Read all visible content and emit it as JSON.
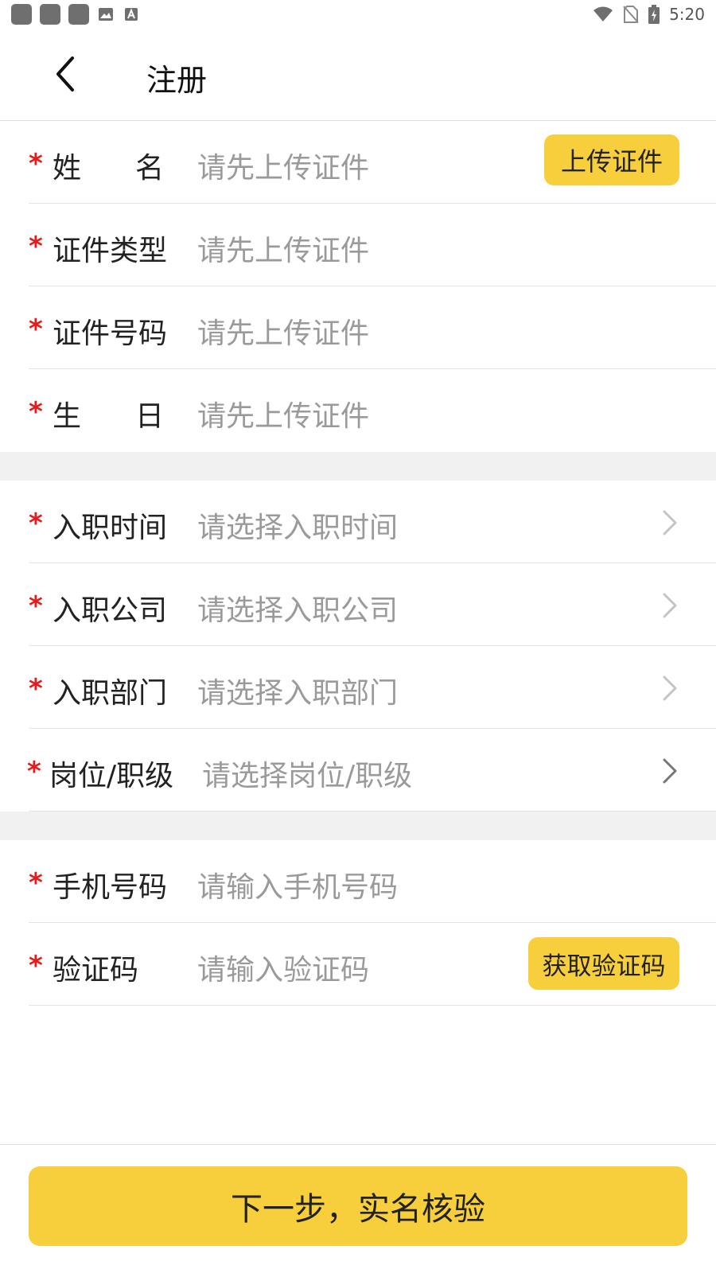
{
  "status_bar": {
    "time": "5:20",
    "icons": [
      "notification-icon",
      "notification-icon",
      "notification-icon",
      "image-icon",
      "a-icon",
      "wifi-icon",
      "no-sim-icon",
      "battery-icon"
    ]
  },
  "header": {
    "title": "注册",
    "back_icon": "chevron-left-icon"
  },
  "id_section": [
    {
      "label": "姓名",
      "label_chars": [
        "姓",
        "名"
      ],
      "placeholder": "请先上传证件",
      "button": "上传证件"
    },
    {
      "label": "证件类型",
      "placeholder": "请先上传证件"
    },
    {
      "label": "证件号码",
      "placeholder": "请先上传证件"
    },
    {
      "label": "生日",
      "label_chars": [
        "生",
        "日"
      ],
      "placeholder": "请先上传证件"
    }
  ],
  "job_section": [
    {
      "label": "入职时间",
      "placeholder": "请选择入职时间"
    },
    {
      "label": "入职公司",
      "placeholder": "请选择入职公司"
    },
    {
      "label": "入职部门",
      "placeholder": "请选择入职部门"
    },
    {
      "label": "岗位/职级",
      "placeholder": "请选择岗位/职级"
    }
  ],
  "contact_section": [
    {
      "label": "手机号码",
      "placeholder": "请输入手机号码"
    },
    {
      "label": "验证码",
      "placeholder": "请输入验证码",
      "button": "获取验证码"
    }
  ],
  "required_mark": "*",
  "next_button": "下一步，实名核验",
  "colors": {
    "accent": "#f7cf3c",
    "required": "#e81a1a",
    "placeholder": "#9a9a9a",
    "divider": "#e3e3e3",
    "section_gap": "#f1f1f1"
  }
}
